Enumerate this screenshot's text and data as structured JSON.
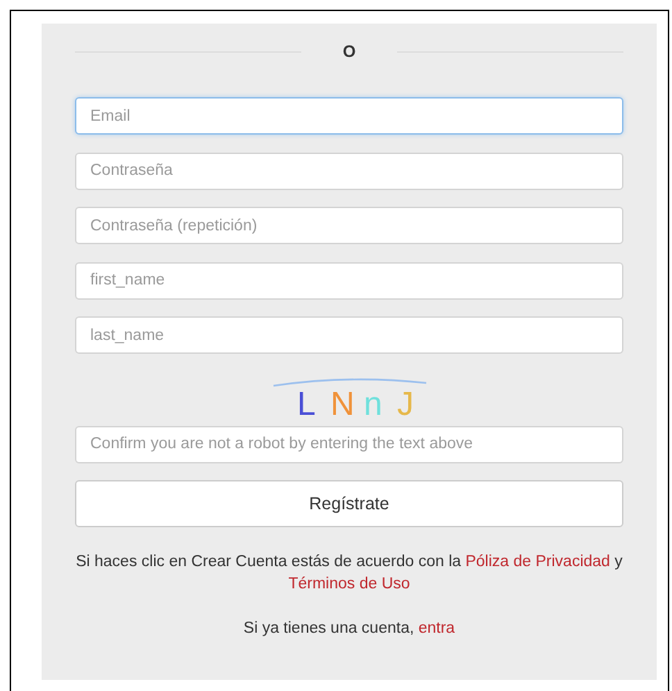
{
  "divider_label": "O",
  "fields": [
    {
      "placeholder": "Email",
      "focused": true
    },
    {
      "placeholder": "Contraseña",
      "focused": false
    },
    {
      "placeholder": "Contraseña (repetición)",
      "focused": false
    },
    {
      "placeholder": "first_name",
      "focused": false
    },
    {
      "placeholder": "last_name",
      "focused": false
    }
  ],
  "captcha": {
    "chars": [
      {
        "char": "L",
        "color": "#4a4fd6"
      },
      {
        "char": "N",
        "color": "#f0923a"
      },
      {
        "char": "n",
        "color": "#6fe0dc"
      },
      {
        "char": "J",
        "color": "#e6b84a"
      }
    ]
  },
  "captcha_field": {
    "placeholder": "Confirm you are not a robot by entering the text above"
  },
  "submit": "Regístrate",
  "legal": {
    "text": "Si haces clic en Crear Cuenta estás de acuerdo con la",
    "privacy_link": "Póliza de Privacidad",
    "joiner": "y",
    "terms_link": "Términos de Uso"
  },
  "login": {
    "text": "Si ya tienes una cuenta,",
    "link": "entra"
  }
}
